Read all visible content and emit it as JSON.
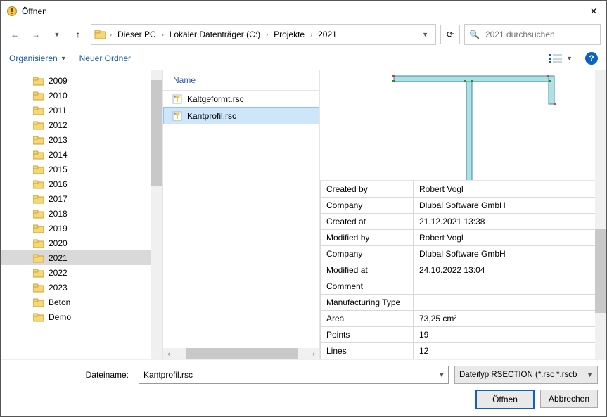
{
  "window": {
    "title": "Öffnen"
  },
  "nav": {
    "crumbs": [
      "Dieser PC",
      "Lokaler Datenträger (C:)",
      "Projekte",
      "2021"
    ],
    "search_placeholder": "2021 durchsuchen"
  },
  "toolbar": {
    "organize": "Organisieren",
    "newfolder": "Neuer Ordner"
  },
  "tree": {
    "items": [
      "2009",
      "2010",
      "2011",
      "2012",
      "2013",
      "2014",
      "2015",
      "2016",
      "2017",
      "2018",
      "2019",
      "2020",
      "2021",
      "2022",
      "2023",
      "Beton",
      "Demo"
    ],
    "selected_index": 12
  },
  "files": {
    "header": "Name",
    "items": [
      "Kaltgeformt.rsc",
      "Kantprofil.rsc"
    ],
    "selected_index": 1
  },
  "details": {
    "rows": [
      {
        "label": "Created by",
        "value": "Robert Vogl"
      },
      {
        "label": "Company",
        "value": "Dlubal Software GmbH"
      },
      {
        "label": "Created at",
        "value": "21.12.2021 13:38"
      },
      {
        "label": "Modified by",
        "value": "Robert Vogl"
      },
      {
        "label": "Company",
        "value": "Dlubal Software GmbH"
      },
      {
        "label": "Modified at",
        "value": "24.10.2022 13:04"
      },
      {
        "label": "Comment",
        "value": ""
      },
      {
        "label": "Manufacturing Type",
        "value": ""
      },
      {
        "label": "Area",
        "value": "73,25 cm²"
      },
      {
        "label": "Points",
        "value": "19"
      },
      {
        "label": "Lines",
        "value": "12"
      }
    ]
  },
  "footer": {
    "filename_label": "Dateiname:",
    "filename_value": "Kantprofil.rsc",
    "filetype": "Dateityp RSECTION (*.rsc *.rscb",
    "open": "Öffnen",
    "cancel": "Abbrechen"
  },
  "glyphs": {
    "help": "?",
    "dropdown": "▼",
    "chev_right": "›",
    "chev_left": "‹",
    "up": "↑",
    "back": "←",
    "fwd": "→",
    "close": "✕",
    "refresh": "⟳",
    "search": "🔍"
  }
}
